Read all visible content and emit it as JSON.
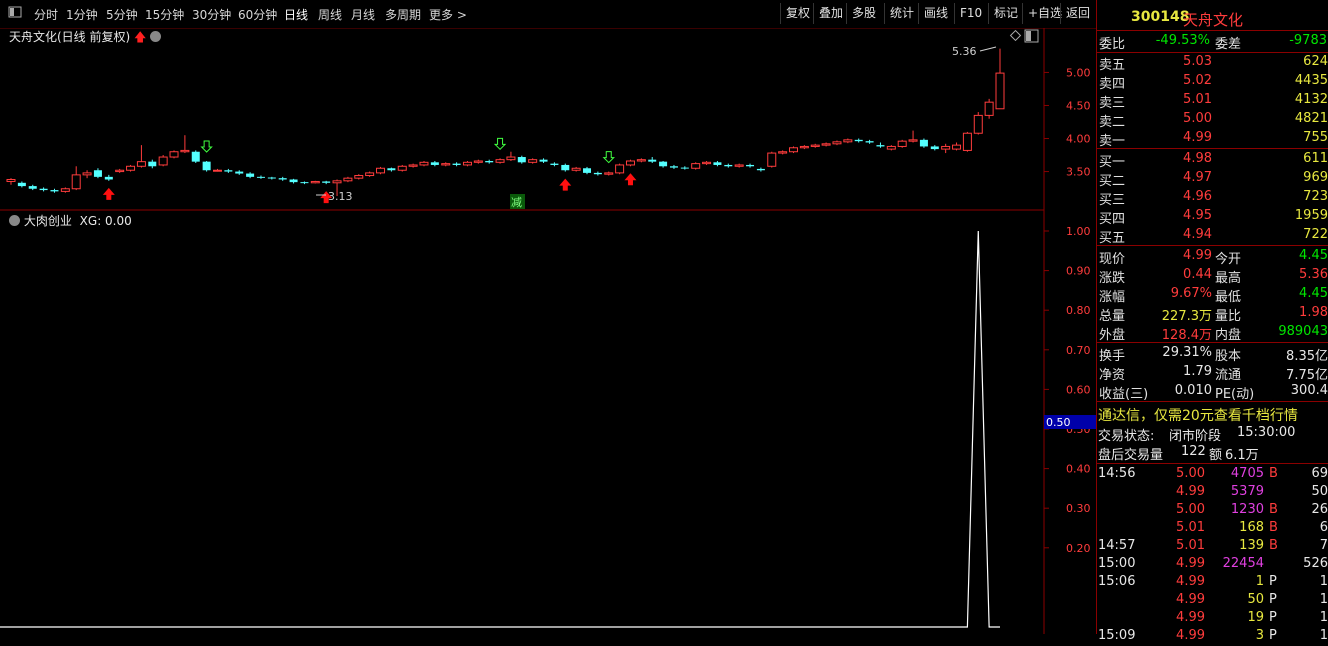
{
  "toolbar": {
    "periods": [
      "分时",
      "1分钟",
      "5分钟",
      "15分钟",
      "30分钟",
      "60分钟",
      "日线",
      "周线",
      "月线",
      "多周期",
      "更多 >"
    ],
    "active_period": "日线",
    "actions": [
      "复权",
      "叠加",
      "多股",
      "统计",
      "画线",
      "F10",
      "标记",
      "+自选",
      "返回"
    ]
  },
  "kline": {
    "title": "天舟文化(日线 前复权)",
    "y_ticks": [
      "5.00",
      "4.50",
      "4.00",
      "3.50"
    ],
    "high_label": "5.36",
    "low_label": "3.13",
    "mark_label": "减"
  },
  "indicator": {
    "title": "大肉创业",
    "value_label": "XG: 0.00",
    "y_ticks": [
      "1.00",
      "0.90",
      "0.80",
      "0.70",
      "0.60",
      "0.50",
      "0.40",
      "0.30",
      "0.20"
    ],
    "cursor_value": "0.50"
  },
  "quote": {
    "code": "300148",
    "name": "天舟文化",
    "weibi_label": "委比",
    "weibi": "-49.53%",
    "weicha_label": "委差",
    "weicha": "-9783",
    "asks": [
      {
        "label": "卖五",
        "price": "5.03",
        "vol": "624"
      },
      {
        "label": "卖四",
        "price": "5.02",
        "vol": "4435"
      },
      {
        "label": "卖三",
        "price": "5.01",
        "vol": "4132"
      },
      {
        "label": "卖二",
        "price": "5.00",
        "vol": "4821"
      },
      {
        "label": "卖一",
        "price": "4.99",
        "vol": "755"
      }
    ],
    "bids": [
      {
        "label": "买一",
        "price": "4.98",
        "vol": "611"
      },
      {
        "label": "买二",
        "price": "4.97",
        "vol": "969"
      },
      {
        "label": "买三",
        "price": "4.96",
        "vol": "723"
      },
      {
        "label": "买四",
        "price": "4.95",
        "vol": "1959"
      },
      {
        "label": "买五",
        "price": "4.94",
        "vol": "722"
      }
    ],
    "stats": [
      {
        "l1": "现价",
        "v1": "4.99",
        "c1": "red",
        "l2": "今开",
        "v2": "4.45",
        "c2": "grn"
      },
      {
        "l1": "涨跌",
        "v1": "0.44",
        "c1": "red",
        "l2": "最高",
        "v2": "5.36",
        "c2": "red"
      },
      {
        "l1": "涨幅",
        "v1": "9.67%",
        "c1": "red",
        "l2": "最低",
        "v2": "4.45",
        "c2": "grn"
      },
      {
        "l1": "总量",
        "v1": "227.3万",
        "c1": "yel",
        "l2": "量比",
        "v2": "1.98",
        "c2": "red"
      },
      {
        "l1": "外盘",
        "v1": "128.4万",
        "c1": "red",
        "l2": "内盘",
        "v2": "989043",
        "c2": "grn"
      }
    ],
    "stats2": [
      {
        "l1": "换手",
        "v1": "29.31%",
        "l2": "股本",
        "v2": "8.35亿"
      },
      {
        "l1": "净资",
        "v1": "1.79",
        "l2": "流通",
        "v2": "7.75亿"
      },
      {
        "l1": "收益(三)",
        "v1": "0.010",
        "l2": "PE(动)",
        "v2": "300.4"
      }
    ],
    "ad": "通达信，仅需20元查看千档行情",
    "trade_state_label": "交易状态:",
    "trade_state": "闭市阶段",
    "trade_time": "15:30:00",
    "after_label": "盘后交易量",
    "after_vol": "122",
    "after_amt_label": "额",
    "after_amt": "6.1万"
  },
  "ticks": [
    {
      "time": "14:56",
      "price": "5.00",
      "pc": "red",
      "vol": "4705",
      "vc": "mag",
      "side": "B",
      "num": "69"
    },
    {
      "time": "",
      "price": "4.99",
      "pc": "red",
      "vol": "5379",
      "vc": "mag",
      "side": "",
      "num": "50"
    },
    {
      "time": "",
      "price": "5.00",
      "pc": "red",
      "vol": "1230",
      "vc": "mag",
      "side": "B",
      "num": "26"
    },
    {
      "time": "",
      "price": "5.01",
      "pc": "red",
      "vol": "168",
      "vc": "yel",
      "side": "B",
      "num": "6"
    },
    {
      "time": "14:57",
      "price": "5.01",
      "pc": "red",
      "vol": "139",
      "vc": "yel",
      "side": "B",
      "num": "7"
    },
    {
      "time": "15:00",
      "price": "4.99",
      "pc": "red",
      "vol": "22454",
      "vc": "mag",
      "side": "",
      "num": "526"
    },
    {
      "time": "15:06",
      "price": "4.99",
      "pc": "red",
      "vol": "1",
      "vc": "yel",
      "side": "P",
      "num": "1"
    },
    {
      "time": "",
      "price": "4.99",
      "pc": "red",
      "vol": "50",
      "vc": "yel",
      "side": "P",
      "num": "1"
    },
    {
      "time": "",
      "price": "4.99",
      "pc": "red",
      "vol": "19",
      "vc": "yel",
      "side": "P",
      "num": "1"
    },
    {
      "time": "15:09",
      "price": "4.99",
      "pc": "red",
      "vol": "3",
      "vc": "yel",
      "side": "P",
      "num": "1"
    }
  ],
  "colors": {
    "up": "#ff3c3c",
    "down": "#54ffff",
    "frame": "#8b0000",
    "text": "#e0e0e0"
  },
  "candles": [
    [
      3.35,
      3.38,
      3.3,
      3.4
    ],
    [
      3.33,
      3.28,
      3.26,
      3.35
    ],
    [
      3.28,
      3.24,
      3.22,
      3.3
    ],
    [
      3.24,
      3.22,
      3.2,
      3.26
    ],
    [
      3.22,
      3.2,
      3.18,
      3.24
    ],
    [
      3.2,
      3.24,
      3.18,
      3.26
    ],
    [
      3.24,
      3.45,
      3.22,
      3.58
    ],
    [
      3.45,
      3.48,
      3.4,
      3.52
    ],
    [
      3.52,
      3.42,
      3.4,
      3.55
    ],
    [
      3.42,
      3.38,
      3.36,
      3.45
    ],
    [
      3.5,
      3.52,
      3.48,
      3.54
    ],
    [
      3.52,
      3.58,
      3.5,
      3.6
    ],
    [
      3.58,
      3.65,
      3.56,
      3.9
    ],
    [
      3.65,
      3.58,
      3.55,
      3.68
    ],
    [
      3.6,
      3.72,
      3.58,
      3.75
    ],
    [
      3.72,
      3.8,
      3.7,
      3.82
    ],
    [
      3.8,
      3.82,
      3.78,
      4.05
    ],
    [
      3.8,
      3.65,
      3.63,
      3.82
    ],
    [
      3.65,
      3.52,
      3.5,
      3.66
    ],
    [
      3.52,
      3.52,
      3.5,
      3.54
    ],
    [
      3.52,
      3.5,
      3.48,
      3.54
    ],
    [
      3.5,
      3.47,
      3.45,
      3.52
    ],
    [
      3.47,
      3.42,
      3.4,
      3.49
    ],
    [
      3.42,
      3.41,
      3.39,
      3.44
    ],
    [
      3.41,
      3.4,
      3.38,
      3.42
    ],
    [
      3.4,
      3.38,
      3.36,
      3.42
    ],
    [
      3.38,
      3.34,
      3.32,
      3.39
    ],
    [
      3.34,
      3.33,
      3.31,
      3.35
    ],
    [
      3.33,
      3.35,
      3.32,
      3.36
    ],
    [
      3.35,
      3.33,
      3.31,
      3.36
    ],
    [
      3.33,
      3.36,
      3.13,
      3.38
    ],
    [
      3.36,
      3.4,
      3.34,
      3.42
    ],
    [
      3.4,
      3.44,
      3.38,
      3.46
    ],
    [
      3.44,
      3.48,
      3.42,
      3.5
    ],
    [
      3.48,
      3.55,
      3.46,
      3.57
    ],
    [
      3.55,
      3.52,
      3.5,
      3.56
    ],
    [
      3.52,
      3.58,
      3.5,
      3.6
    ],
    [
      3.58,
      3.6,
      3.56,
      3.62
    ],
    [
      3.6,
      3.64,
      3.58,
      3.66
    ],
    [
      3.64,
      3.6,
      3.58,
      3.66
    ],
    [
      3.6,
      3.62,
      3.58,
      3.64
    ],
    [
      3.62,
      3.6,
      3.58,
      3.64
    ],
    [
      3.6,
      3.64,
      3.58,
      3.66
    ],
    [
      3.64,
      3.66,
      3.62,
      3.68
    ],
    [
      3.66,
      3.64,
      3.62,
      3.68
    ],
    [
      3.64,
      3.68,
      3.62,
      3.7
    ],
    [
      3.68,
      3.72,
      3.66,
      3.8
    ],
    [
      3.72,
      3.64,
      3.62,
      3.74
    ],
    [
      3.64,
      3.68,
      3.62,
      3.7
    ],
    [
      3.68,
      3.65,
      3.63,
      3.7
    ],
    [
      3.62,
      3.6,
      3.58,
      3.64
    ],
    [
      3.6,
      3.52,
      3.5,
      3.62
    ],
    [
      3.52,
      3.55,
      3.5,
      3.57
    ],
    [
      3.55,
      3.48,
      3.46,
      3.57
    ],
    [
      3.48,
      3.46,
      3.44,
      3.5
    ],
    [
      3.46,
      3.48,
      3.44,
      3.5
    ],
    [
      3.48,
      3.6,
      3.46,
      3.62
    ],
    [
      3.6,
      3.66,
      3.58,
      3.68
    ],
    [
      3.66,
      3.68,
      3.64,
      3.7
    ],
    [
      3.68,
      3.65,
      3.63,
      3.72
    ],
    [
      3.65,
      3.58,
      3.56,
      3.66
    ],
    [
      3.58,
      3.56,
      3.54,
      3.6
    ],
    [
      3.56,
      3.55,
      3.53,
      3.58
    ],
    [
      3.55,
      3.62,
      3.53,
      3.64
    ],
    [
      3.62,
      3.64,
      3.6,
      3.66
    ],
    [
      3.64,
      3.6,
      3.58,
      3.66
    ],
    [
      3.6,
      3.58,
      3.56,
      3.62
    ],
    [
      3.58,
      3.6,
      3.56,
      3.62
    ],
    [
      3.6,
      3.58,
      3.56,
      3.62
    ],
    [
      3.54,
      3.52,
      3.5,
      3.56
    ],
    [
      3.58,
      3.78,
      3.56,
      3.8
    ],
    [
      3.78,
      3.8,
      3.76,
      3.82
    ],
    [
      3.8,
      3.86,
      3.78,
      3.88
    ],
    [
      3.86,
      3.88,
      3.84,
      3.9
    ],
    [
      3.88,
      3.9,
      3.86,
      3.92
    ],
    [
      3.9,
      3.92,
      3.88,
      3.94
    ],
    [
      3.92,
      3.95,
      3.9,
      3.97
    ],
    [
      3.95,
      3.98,
      3.93,
      4.0
    ],
    [
      3.98,
      3.96,
      3.94,
      4.0
    ],
    [
      3.96,
      3.94,
      3.92,
      3.98
    ],
    [
      3.9,
      3.88,
      3.86,
      3.94
    ],
    [
      3.84,
      3.88,
      3.82,
      3.9
    ],
    [
      3.88,
      3.96,
      3.86,
      3.98
    ],
    [
      3.96,
      3.98,
      3.94,
      4.12
    ],
    [
      3.98,
      3.88,
      3.86,
      4.0
    ],
    [
      3.88,
      3.84,
      3.82,
      3.9
    ],
    [
      3.84,
      3.88,
      3.78,
      3.92
    ],
    [
      3.84,
      3.9,
      3.82,
      3.94
    ],
    [
      3.82,
      4.08,
      3.8,
      4.1
    ],
    [
      4.08,
      4.35,
      4.06,
      4.4
    ],
    [
      4.35,
      4.55,
      4.3,
      4.6
    ],
    [
      4.45,
      4.99,
      4.45,
      5.36
    ]
  ],
  "signals": [
    {
      "index": 9,
      "type": "up"
    },
    {
      "index": 18,
      "type": "down"
    },
    {
      "index": 29,
      "type": "up"
    },
    {
      "index": 45,
      "type": "down"
    },
    {
      "index": 51,
      "type": "up"
    },
    {
      "index": 55,
      "type": "down"
    },
    {
      "index": 57,
      "type": "up"
    }
  ],
  "xg_peak_index": 89
}
